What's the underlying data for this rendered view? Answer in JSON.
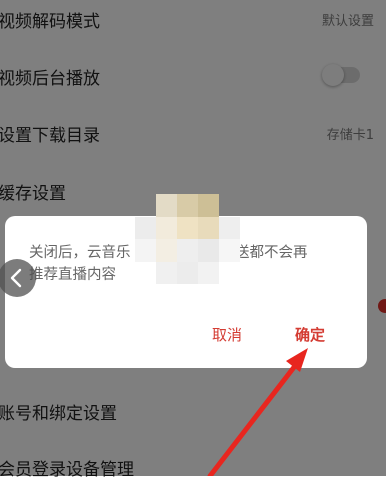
{
  "settings": {
    "rows": [
      {
        "label": "视频解码模式",
        "value": "默认设置"
      },
      {
        "label": "视频后台播放"
      },
      {
        "label": "设置下载目录",
        "value": "存储卡1"
      },
      {
        "label": "缓存设置"
      },
      {
        "label": ""
      },
      {
        "label": ""
      },
      {
        "label": ""
      },
      {
        "label": "账号和绑定设置"
      },
      {
        "label": "会员登录设备管理"
      }
    ]
  },
  "dialog": {
    "message_part1": "关闭后，云音乐",
    "message_part2": "推送都不会再",
    "message_line2": "推荐直播内容",
    "cancel_label": "取消",
    "confirm_label": "确定"
  },
  "icons": {
    "back": "chevron-left-icon",
    "arrow": "red-arrow-annotation"
  },
  "colors": {
    "accent": "#d43c33",
    "arrow": "#e8261f",
    "toggle_off": "#d9d9d9"
  }
}
